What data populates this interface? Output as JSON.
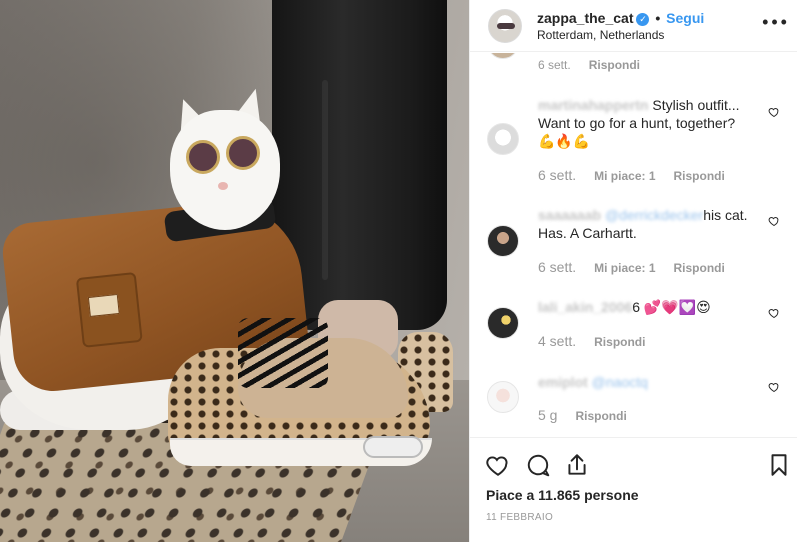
{
  "header": {
    "username": "zappa_the_cat",
    "verified_icon": "verified-badge-icon",
    "separator": "•",
    "follow_label": "Segui",
    "location": "Rotterdam, Netherlands",
    "more_icon": "more-options-icon"
  },
  "comments": [
    {
      "text": "",
      "time": "6 sett.",
      "likes": "",
      "reply": "Rispondi"
    },
    {
      "username": "martinahappertn",
      "text": "Stylish outfit... Want to go for a hunt, together?",
      "emoji": "💪🔥💪",
      "time": "6 sett.",
      "likes": "Mi piace: 1",
      "reply": "Rispondi"
    },
    {
      "username": "saaaaaab",
      "mention": "@derrickdecker",
      "text": "his cat. Has. A Carhartt.",
      "time": "6 sett.",
      "likes": "Mi piace: 1",
      "reply": "Rispondi"
    },
    {
      "username": "lali_akin_2006",
      "text": "6",
      "emoji": "💕💗💟😍",
      "time": "4 sett.",
      "likes": "",
      "reply": "Rispondi"
    },
    {
      "username": "emiplot",
      "mention": "@naoctq",
      "text": "",
      "time": "5 g",
      "likes": "",
      "reply": "Rispondi"
    }
  ],
  "actions": {
    "like_icon": "heart-icon",
    "comment_icon": "comment-icon",
    "share_icon": "share-icon",
    "save_icon": "bookmark-icon"
  },
  "likes_text": "Piace a 11.865 persone",
  "date": "11 FEBBRAIO",
  "colors": {
    "accent": "#3897f0",
    "text": "#262626",
    "muted": "#999999",
    "border": "#efefef"
  }
}
